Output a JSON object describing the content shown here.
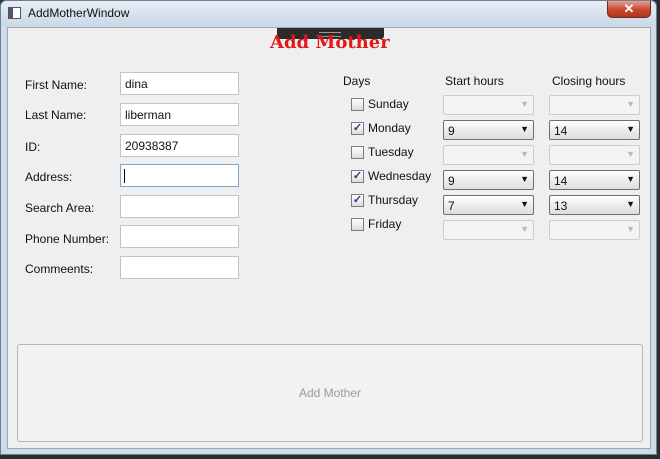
{
  "window": {
    "title": "AddMotherWindow",
    "close_glyph": "✕"
  },
  "heading": "Add Mother",
  "form": {
    "first_name": {
      "label": "First Name:",
      "value": "dina"
    },
    "last_name": {
      "label": "Last Name:",
      "value": "liberman"
    },
    "id": {
      "label": "ID:",
      "value": "20938387"
    },
    "address": {
      "label": "Address:",
      "value": ""
    },
    "search_area": {
      "label": "Search Area:",
      "value": ""
    },
    "phone": {
      "label": "Phone Number:",
      "value": ""
    },
    "comments": {
      "label": "Commeents:",
      "value": ""
    }
  },
  "schedule": {
    "days_header": "Days",
    "start_header": "Start hours",
    "closing_header": "Closing hours",
    "rows": [
      {
        "day": "Sunday",
        "checked": false,
        "checkmark": "",
        "start": "",
        "close": ""
      },
      {
        "day": "Monday",
        "checked": true,
        "checkmark": "✓",
        "start": "9",
        "close": "14"
      },
      {
        "day": "Tuesday",
        "checked": false,
        "checkmark": "",
        "start": "",
        "close": ""
      },
      {
        "day": "Wednesday",
        "checked": true,
        "checkmark": "✓",
        "start": "9",
        "close": "14"
      },
      {
        "day": "Thursday",
        "checked": true,
        "checkmark": "✓",
        "start": "7",
        "close": "13"
      },
      {
        "day": "Friday",
        "checked": false,
        "checkmark": "",
        "start": "",
        "close": ""
      }
    ]
  },
  "arrow_glyph": "▼",
  "submit_label": "Add Mother",
  "colors": {
    "heading": "#e0191b",
    "close_button": "#c8462f"
  }
}
